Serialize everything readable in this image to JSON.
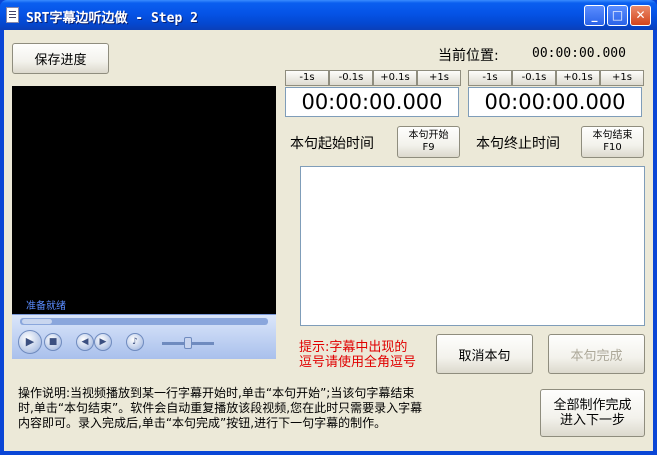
{
  "window": {
    "title": "SRT字幕边听边做 - Step 2",
    "controls": {
      "minimize": "_",
      "maximize": "□",
      "close": "✕"
    }
  },
  "toolbar": {
    "save_label": "保存进度"
  },
  "position": {
    "label": "当前位置:",
    "value": "00:00:00.000"
  },
  "start": {
    "steps": [
      "-1s",
      "-0.1s",
      "+0.1s",
      "+1s"
    ],
    "time": "00:00:00.000",
    "label": "本句起始时间",
    "button_line1": "本句开始",
    "button_line2": "F9"
  },
  "end": {
    "steps": [
      "-1s",
      "-0.1s",
      "+0.1s",
      "+1s"
    ],
    "time": "00:00:00.000",
    "label": "本句终止时间",
    "button_line1": "本句结束",
    "button_line2": "F10"
  },
  "subtitle_text": "",
  "player": {
    "status": "准备就绪",
    "icons": [
      "play-icon",
      "stop-icon",
      "previous-icon",
      "next-icon",
      "volume-icon"
    ]
  },
  "hint": {
    "line1": "提示:字幕中出现的",
    "line2": "逗号请使用全角逗号"
  },
  "actions": {
    "cancel_label": "取消本句",
    "done_label": "本句完成",
    "finish_line1": "全部制作完成",
    "finish_line2": "进入下一步"
  },
  "help": {
    "line1": "操作说明:当视频播放到某一行字幕开始时,单击“本句开始”;当该句字幕结束",
    "line2": "时,单击“本句结束”。软件会自动重复播放该段视频,您在此时只需要录入字幕",
    "line3": "内容即可。录入完成后,单击“本句完成”按钮,进行下一句字幕的制作。"
  },
  "colors": {
    "titlebar": "#0553e6",
    "face": "#ece9d8",
    "hint": "#e00000",
    "video": "#000000"
  }
}
